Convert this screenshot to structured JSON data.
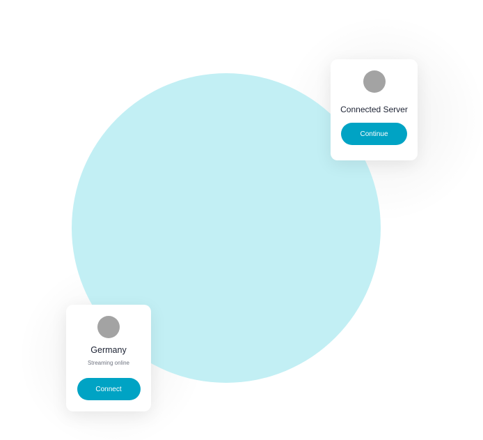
{
  "server_card": {
    "title": "Connected Server",
    "button_label": "Continue"
  },
  "country_card": {
    "title": "Germany",
    "subtitle": "Streaming online",
    "button_label": "Connect"
  },
  "colors": {
    "accent": "#00a3c4",
    "circle": "#c2eff4",
    "avatar": "#a3a3a3",
    "text": "#1c2233"
  }
}
